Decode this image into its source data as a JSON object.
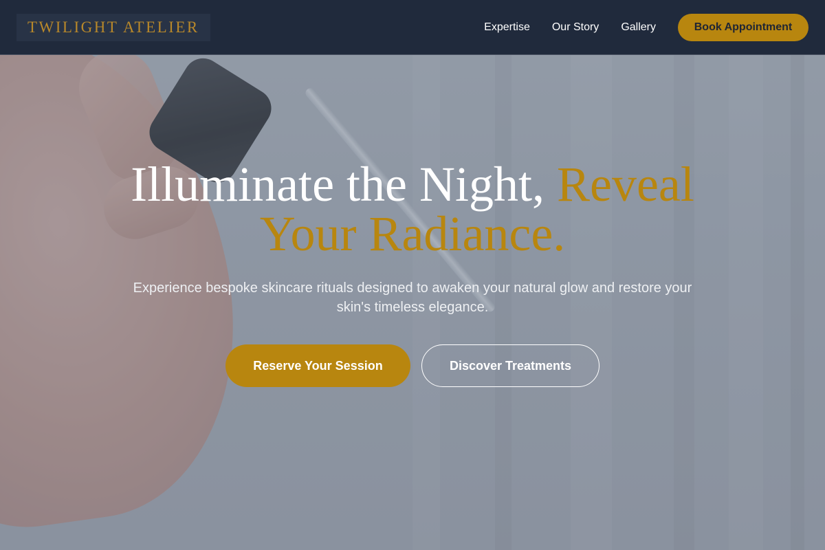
{
  "header": {
    "brand": "TWILIGHT ATELIER",
    "nav": [
      {
        "label": "Expertise"
      },
      {
        "label": "Our Story"
      },
      {
        "label": "Gallery"
      }
    ],
    "cta_label": "Book Appointment"
  },
  "hero": {
    "headline_main": "Illuminate the Night, ",
    "headline_accent": "Reveal Your Radiance.",
    "subtitle": "Experience bespoke skincare rituals designed to awaken your natural glow and restore your skin's timeless elegance.",
    "primary_cta": "Reserve Your Session",
    "secondary_cta": "Discover Treatments",
    "background_image": "hand holding a skincare serum dropper"
  },
  "colors": {
    "accent": "#b8860f",
    "header_bg": "#202a3c",
    "text_light": "#ffffff"
  }
}
